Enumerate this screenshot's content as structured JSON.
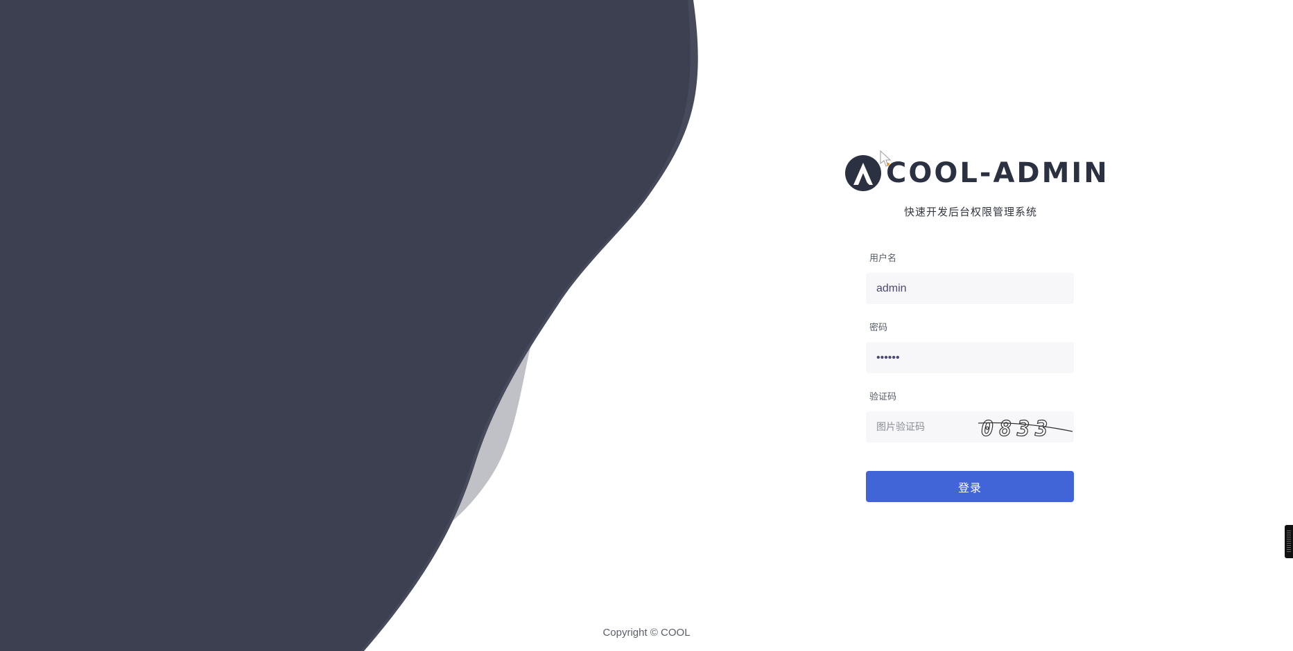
{
  "brand": {
    "name": "COOL-ADMIN",
    "subtitle": "快速开发后台权限管理系统",
    "logo_icon": "cool-admin-logo-icon"
  },
  "form": {
    "username_label": "用户名",
    "username_value": "admin",
    "password_label": "密码",
    "password_value": "123456",
    "captcha_label": "验证码",
    "captcha_placeholder": "图片验证码",
    "captcha_text": "0833",
    "login_label": "登录"
  },
  "footer": {
    "copyright": "Copyright © COOL"
  },
  "colors": {
    "dark_shape": "#3d4050",
    "light_shape": "#c0c1c7",
    "primary_button": "#4165d7",
    "input_background": "#f7f7f9"
  }
}
